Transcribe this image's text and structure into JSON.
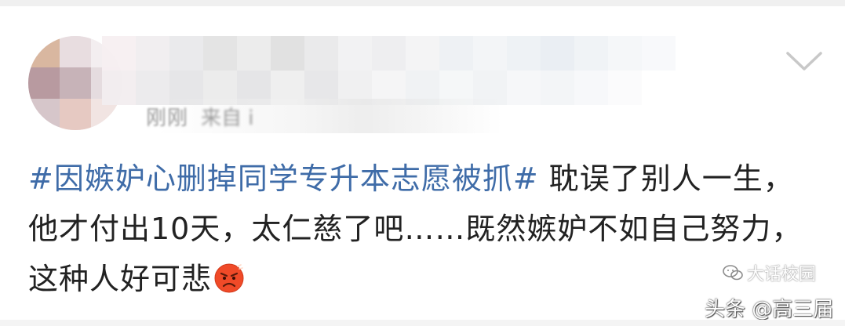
{
  "post": {
    "meta": {
      "time": "刚刚",
      "source": "来自 i"
    },
    "hashtag": "#因嫉妒心删掉同学专升本志愿被抓#",
    "body_line1": " 耽误了别人一生，他才付出10天，太仁慈了吧……既然嫉妒不如自己努力，这种人好可悲",
    "emoji": "angry-face"
  },
  "watermark": {
    "line1": "大话校园",
    "line2": "头条 @高三届"
  },
  "colors": {
    "hashtag": "#3f6ca8",
    "text": "#222222",
    "meta": "#9a9a9a"
  },
  "icons": {
    "more": "chevron-down-icon",
    "emoji": "angry-emoji-icon",
    "watermark": "wechat-icon"
  }
}
